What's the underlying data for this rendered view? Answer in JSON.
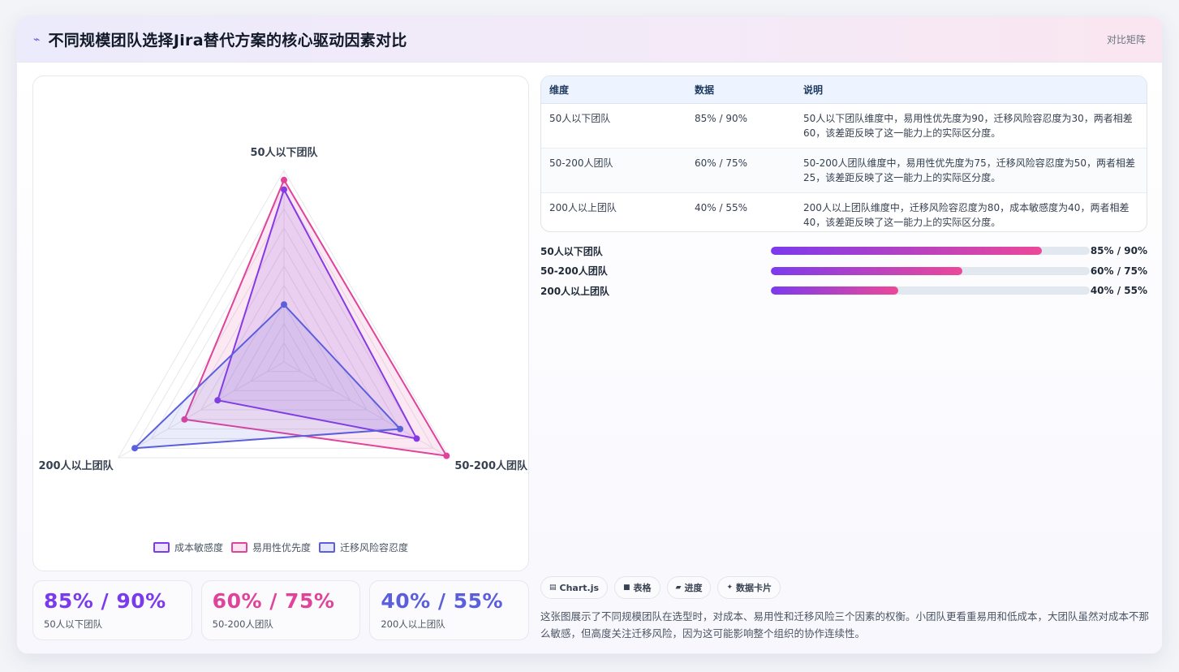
{
  "header": {
    "title": "不同规模团队选择Jira替代方案的核心驱动因素对比",
    "tag": "对比矩阵"
  },
  "chart_data": {
    "type": "radar",
    "axes": [
      "50人以下团队",
      "50-200人团队",
      "200人以上团队"
    ],
    "max": 100,
    "grid_levels": 10,
    "series": [
      {
        "name": "成本敏感度",
        "values": [
          90,
          80,
          40
        ],
        "color": "#7c3aed"
      },
      {
        "name": "易用性优先度",
        "values": [
          95,
          98,
          60
        ],
        "color": "#e0439a"
      },
      {
        "name": "迁移风险容忍度",
        "values": [
          30,
          70,
          90
        ],
        "color": "#5b5fdb"
      }
    ],
    "legend": "bottom"
  },
  "legend": [
    {
      "label": "成本敏感度",
      "color": "#7c3aed",
      "fill": "#efe4fd"
    },
    {
      "label": "易用性优先度",
      "color": "#e0439a",
      "fill": "#fbe4ef"
    },
    {
      "label": "迁移风险容忍度",
      "color": "#5b5fdb",
      "fill": "#e4e6fb"
    }
  ],
  "kpis": [
    {
      "value": "85% / 90%",
      "label": "50人以下团队",
      "color": "#7c3aed"
    },
    {
      "value": "60% / 75%",
      "label": "50-200人团队",
      "color": "#e0439a"
    },
    {
      "value": "40% / 55%",
      "label": "200人以上团队",
      "color": "#5b5fdb"
    }
  ],
  "table": {
    "headers": [
      "维度",
      "数据",
      "说明"
    ],
    "rows": [
      [
        "50人以下团队",
        "85% / 90%",
        "50人以下团队维度中，易用性优先度为90，迁移风险容忍度为30，两者相差60，该差距反映了这一能力上的实际区分度。"
      ],
      [
        "50-200人团队",
        "60% / 75%",
        "50-200人团队维度中，易用性优先度为75，迁移风险容忍度为50，两者相差25，该差距反映了这一能力上的实际区分度。"
      ],
      [
        "200人以上团队",
        "40% / 55%",
        "200人以上团队维度中，迁移风险容忍度为80，成本敏感度为40，两者相差40，该差距反映了这一能力上的实际区分度。"
      ]
    ]
  },
  "progress": [
    {
      "label": "50人以下团队",
      "value": 0.85,
      "text": "85% / 90%"
    },
    {
      "label": "50-200人团队",
      "value": 0.6,
      "text": "60% / 75%"
    },
    {
      "label": "200人以上团队",
      "value": 0.4,
      "text": "40% / 55%"
    }
  ],
  "chips": [
    {
      "icon": "chart-icon",
      "glyph": "▤",
      "label": "Chart.js"
    },
    {
      "icon": "table-icon",
      "glyph": "■",
      "label": "表格"
    },
    {
      "icon": "progress-icon",
      "glyph": "▰",
      "label": "进度"
    },
    {
      "icon": "card-icon",
      "glyph": "✦",
      "label": "数据卡片"
    }
  ],
  "description": "这张图展示了不同规模团队在选型时，对成本、易用性和迁移风险三个因素的权衡。小团队更看重易用和低成本，大团队虽然对成本不那么敏感，但高度关注迁移风险，因为这可能影响整个组织的协作连续性。"
}
